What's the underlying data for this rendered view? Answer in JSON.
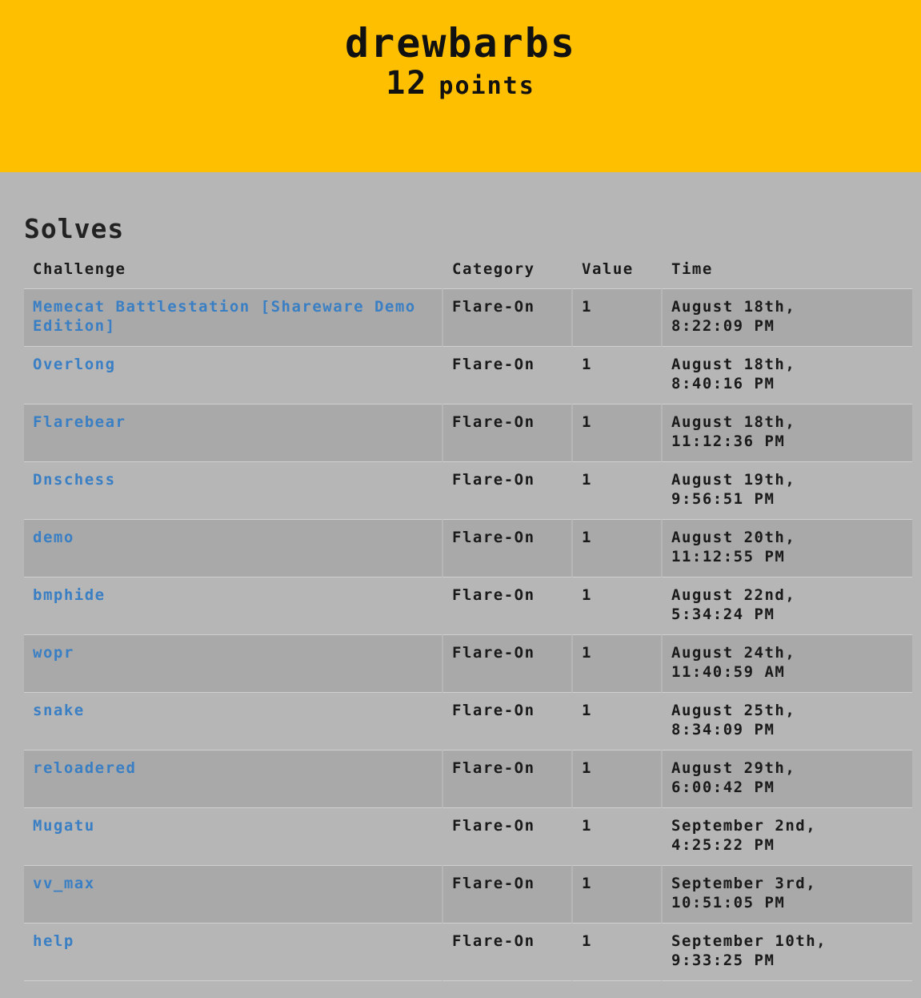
{
  "header": {
    "team_name": "drewbarbs",
    "score_value": "12",
    "score_label": "points"
  },
  "solves": {
    "title": "Solves",
    "columns": [
      "Challenge",
      "Category",
      "Value",
      "Time"
    ],
    "rows": [
      {
        "challenge": "Memecat Battlestation [Shareware Demo Edition]",
        "category": "Flare-On",
        "value": "1",
        "time_date": "August 18th,",
        "time_clock": "8:22:09 PM"
      },
      {
        "challenge": "Overlong",
        "category": "Flare-On",
        "value": "1",
        "time_date": "August 18th,",
        "time_clock": "8:40:16 PM"
      },
      {
        "challenge": "Flarebear",
        "category": "Flare-On",
        "value": "1",
        "time_date": "August 18th,",
        "time_clock": "11:12:36 PM"
      },
      {
        "challenge": "Dnschess",
        "category": "Flare-On",
        "value": "1",
        "time_date": "August 19th,",
        "time_clock": "9:56:51 PM"
      },
      {
        "challenge": "demo",
        "category": "Flare-On",
        "value": "1",
        "time_date": "August 20th,",
        "time_clock": "11:12:55 PM"
      },
      {
        "challenge": "bmphide",
        "category": "Flare-On",
        "value": "1",
        "time_date": "August 22nd,",
        "time_clock": "5:34:24 PM"
      },
      {
        "challenge": "wopr",
        "category": "Flare-On",
        "value": "1",
        "time_date": "August 24th,",
        "time_clock": "11:40:59 AM"
      },
      {
        "challenge": "snake",
        "category": "Flare-On",
        "value": "1",
        "time_date": "August 25th,",
        "time_clock": "8:34:09 PM"
      },
      {
        "challenge": "reloadered",
        "category": "Flare-On",
        "value": "1",
        "time_date": "August 29th,",
        "time_clock": "6:00:42 PM"
      },
      {
        "challenge": "Mugatu",
        "category": "Flare-On",
        "value": "1",
        "time_date": "September 2nd,",
        "time_clock": "4:25:22 PM"
      },
      {
        "challenge": "vv_max",
        "category": "Flare-On",
        "value": "1",
        "time_date": "September 3rd,",
        "time_clock": "10:51:05 PM"
      },
      {
        "challenge": "help",
        "category": "Flare-On",
        "value": "1",
        "time_date": "September 10th,",
        "time_clock": "9:33:25 PM"
      }
    ]
  },
  "colors": {
    "header_bg": "#fdbf00",
    "page_bg": "#b6b6b6",
    "row_alt_bg": "#a9a9a9",
    "link": "#3a7fc4"
  }
}
